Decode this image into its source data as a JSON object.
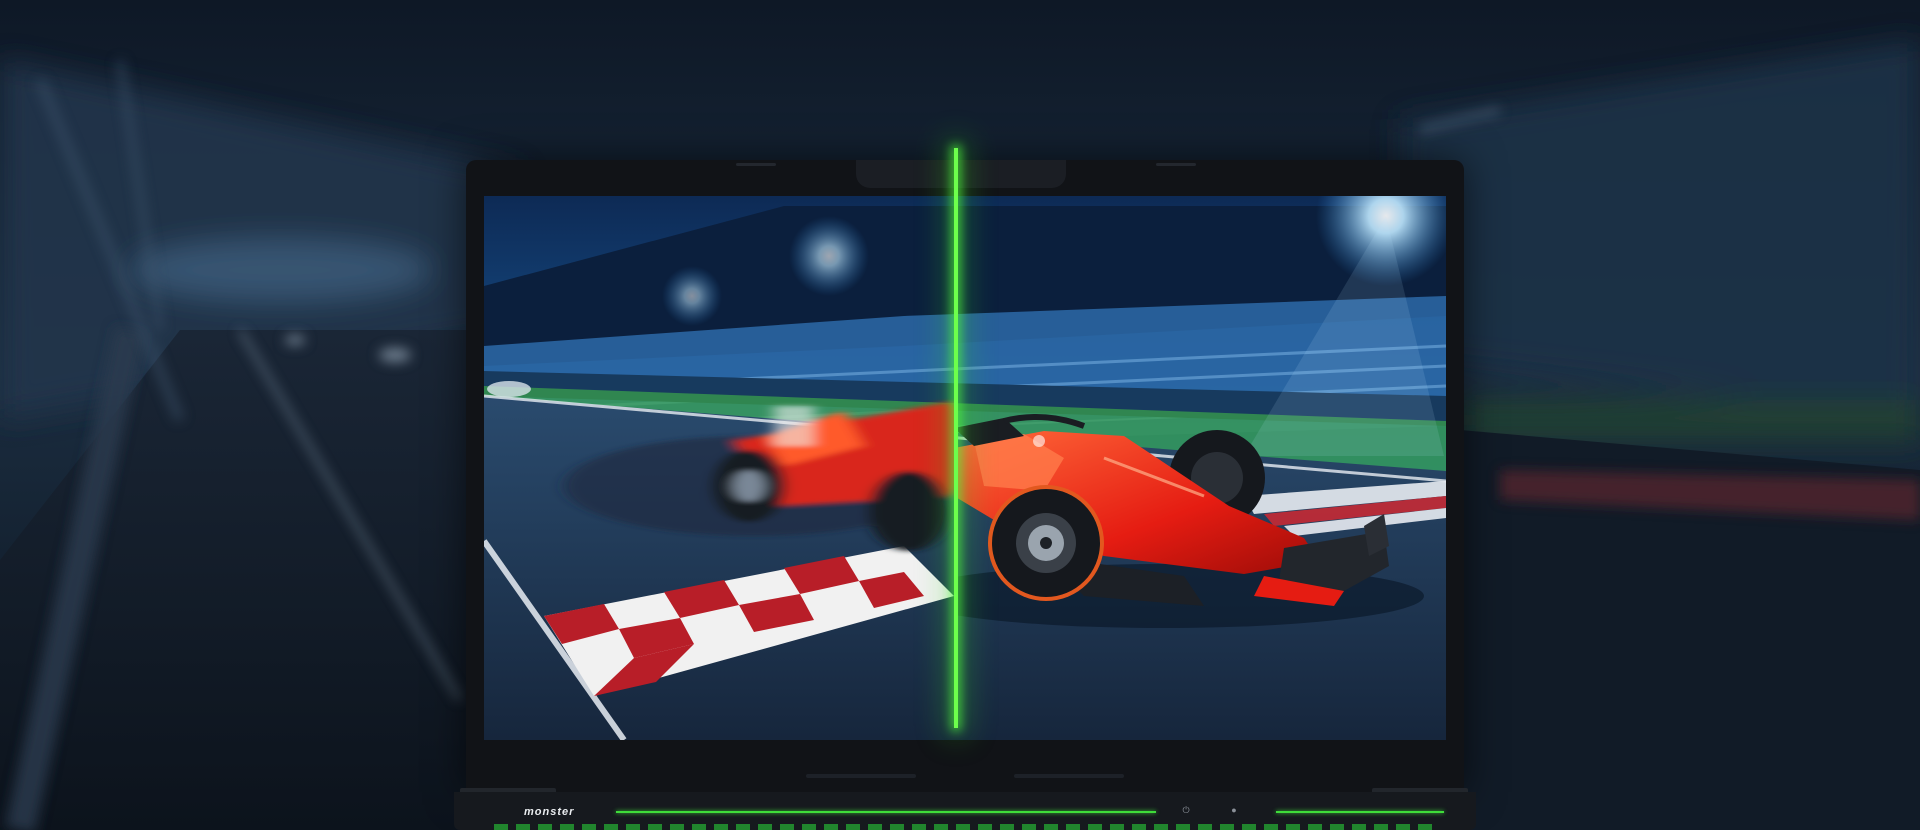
{
  "scene": {
    "brand_logo_text": "monster",
    "accent_color": "#3fdc3a",
    "car_color": "#ff3a1c",
    "checker_colors": [
      "#c8202a",
      "#f2f2f2"
    ]
  }
}
